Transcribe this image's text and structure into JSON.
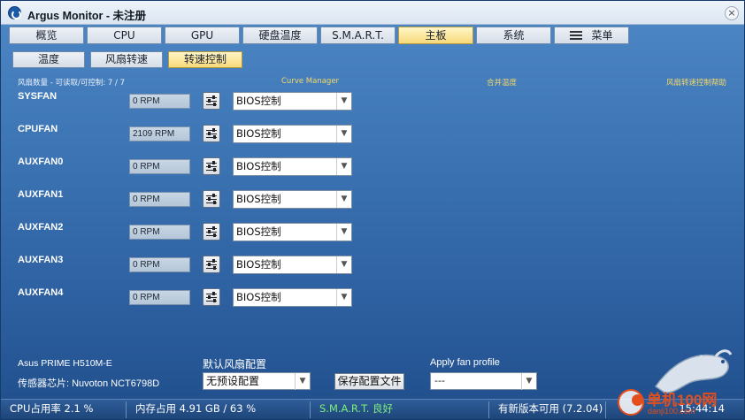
{
  "window": {
    "title": "Argus Monitor - 未注册",
    "close_label": "×"
  },
  "main_tabs": [
    {
      "label": "概览",
      "active": false
    },
    {
      "label": "CPU",
      "active": false
    },
    {
      "label": "GPU",
      "active": false
    },
    {
      "label": "硬盘温度",
      "active": false
    },
    {
      "label": "S.M.A.R.T.",
      "active": false
    },
    {
      "label": "主板",
      "active": true
    },
    {
      "label": "系统",
      "active": false
    },
    {
      "label": "菜单",
      "active": false,
      "icon": "hamburger-menu-icon"
    }
  ],
  "sub_tabs": [
    {
      "label": "温度",
      "active": false
    },
    {
      "label": "风扇转速",
      "active": false
    },
    {
      "label": "转速控制",
      "active": true
    }
  ],
  "header": {
    "fan_count": "风扇数量 - 可读取/可控制: 7 / 7",
    "curve_manager": "Curve Manager",
    "merge_temp": "合并温度",
    "fan_help": "风扇转速控制帮助"
  },
  "fans": [
    {
      "name": "SYSFAN",
      "rpm": "0 RPM",
      "mode": "BIOS控制"
    },
    {
      "name": "CPUFAN",
      "rpm": "2109 RPM",
      "mode": "BIOS控制"
    },
    {
      "name": "AUXFAN0",
      "rpm": "0 RPM",
      "mode": "BIOS控制"
    },
    {
      "name": "AUXFAN1",
      "rpm": "0 RPM",
      "mode": "BIOS控制"
    },
    {
      "name": "AUXFAN2",
      "rpm": "0 RPM",
      "mode": "BIOS控制"
    },
    {
      "name": "AUXFAN3",
      "rpm": "0 RPM",
      "mode": "BIOS控制"
    },
    {
      "name": "AUXFAN4",
      "rpm": "0 RPM",
      "mode": "BIOS控制"
    }
  ],
  "bottom": {
    "board": "Asus PRIME H510M-E",
    "sensor_chip": "传感器芯片: Nuvoton NCT6798D",
    "default_profile_label": "默认风扇配置",
    "default_profile_value": "无预设配置",
    "save_button": "保存配置文件",
    "apply_profile_label": "Apply fan profile",
    "apply_profile_value": "---"
  },
  "statusbar": {
    "cpu": "CPU占用率 2.1 %",
    "memory": "内存占用 4.91 GB / 63 %",
    "smart": "S.M.A.R.T. 良好",
    "update": "有新版本可用 (7.2.04)",
    "time": "15:44:14"
  },
  "watermark": {
    "text": "单机100网",
    "sub": "danji100.com"
  },
  "colors": {
    "accent_link": "#f3d868",
    "active_tab": "#f7d97a",
    "smart_ok": "#7cf07c",
    "watermark": "#e34e1c"
  }
}
